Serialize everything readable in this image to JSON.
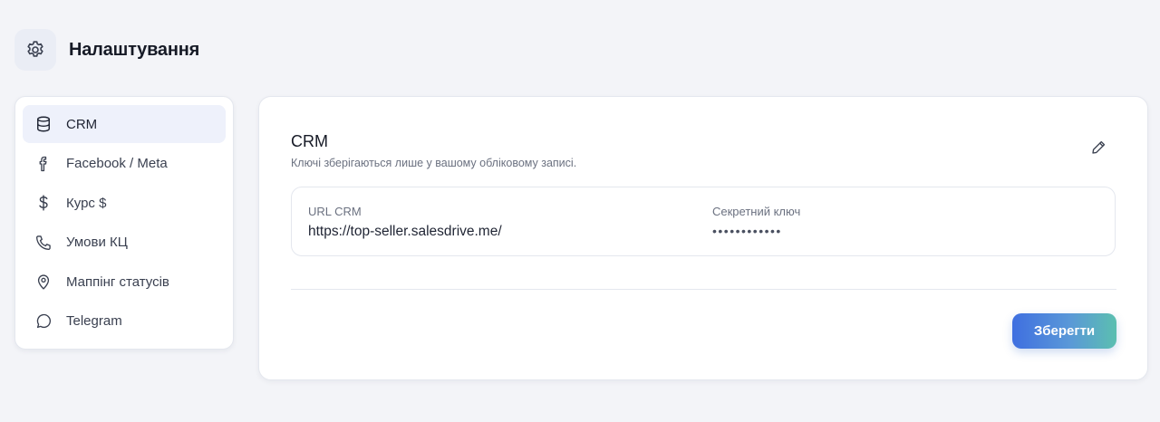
{
  "header": {
    "title": "Налаштування",
    "icon": "gear-icon"
  },
  "sidebar": {
    "items": [
      {
        "label": "CRM",
        "icon": "database-icon",
        "active": true
      },
      {
        "label": "Facebook / Meta",
        "icon": "facebook-icon",
        "active": false
      },
      {
        "label": "Курс $",
        "icon": "dollar-icon",
        "active": false
      },
      {
        "label": "Умови КЦ",
        "icon": "phone-icon",
        "active": false
      },
      {
        "label": "Маппінг статусів",
        "icon": "map-pin-icon",
        "active": false
      },
      {
        "label": "Telegram",
        "icon": "chat-bubble-icon",
        "active": false
      }
    ]
  },
  "main": {
    "title": "CRM",
    "subtitle": "Ключі зберігаються лише у вашому обліковому записі.",
    "edit_icon": "pencil-icon",
    "fields": {
      "url": {
        "label": "URL CRM",
        "value": "https://top-seller.salesdrive.me/"
      },
      "secret": {
        "label": "Секретний ключ",
        "value": "••••••••••••"
      }
    },
    "save_label": "Зберегти"
  },
  "colors": {
    "accent_start": "#3f6fe0",
    "accent_end": "#5bbfb0",
    "active_item_bg": "#eef1fb",
    "page_bg": "#f3f4f8"
  }
}
